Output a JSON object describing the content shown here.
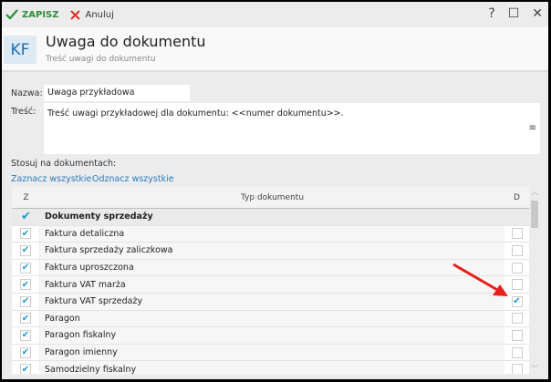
{
  "toolbar": {
    "save_label": "ZAPISZ",
    "cancel_label": "Anuluj"
  },
  "window_controls": {
    "help": "?",
    "maximize": "☐",
    "close": "✕"
  },
  "header": {
    "logo": "KF",
    "title": "Uwaga do dokumentu",
    "subtitle": "Treść uwagi do dokumentu"
  },
  "form": {
    "name_label": "Nazwa:",
    "name_value": "Uwaga przykładowa",
    "content_label": "Treść:",
    "content_value": "Treść uwagi przykładowej dla dokumentu: <<numer dokumentu>>.",
    "apply_label": "Stosuj na dokumentach:",
    "select_all": "Zaznacz wszystkie",
    "deselect_all": "Odznacz wszystkie"
  },
  "table": {
    "col_z": "Z",
    "col_type": "Typ dokumentu",
    "col_d": "D",
    "group": {
      "label": "Dokumenty sprzedaży",
      "z": true
    },
    "rows": [
      {
        "label": "Faktura detaliczna",
        "z": true,
        "d": false
      },
      {
        "label": "Faktura sprzedaży zaliczkowa",
        "z": true,
        "d": false
      },
      {
        "label": "Faktura uproszczona",
        "z": true,
        "d": false
      },
      {
        "label": "Faktura VAT marża",
        "z": true,
        "d": false
      },
      {
        "label": "Faktura VAT sprzedaży",
        "z": true,
        "d": true
      },
      {
        "label": "Paragon",
        "z": true,
        "d": false
      },
      {
        "label": "Paragon fiskalny",
        "z": true,
        "d": false
      },
      {
        "label": "Paragon imienny",
        "z": true,
        "d": false
      },
      {
        "label": "Samodzielny fiskalny",
        "z": true,
        "d": false
      }
    ]
  },
  "colors": {
    "accent": "#1a9ad6",
    "save": "#2e8b3a",
    "arrow": "#e8201c"
  }
}
